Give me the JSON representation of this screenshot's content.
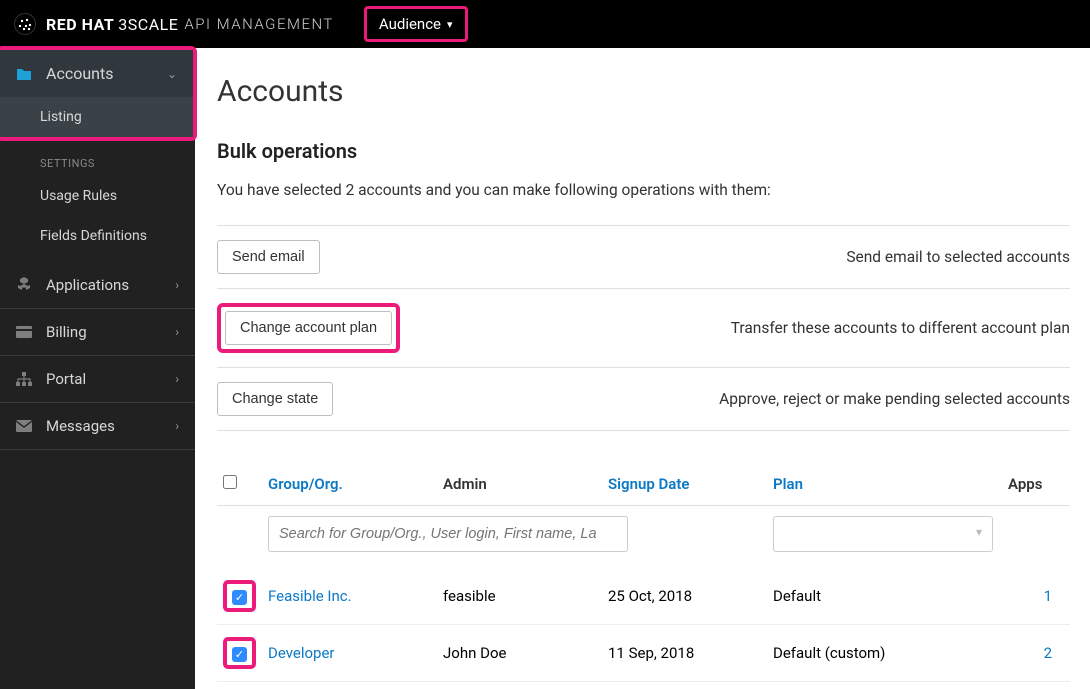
{
  "header": {
    "brand_strong": "RED HAT",
    "brand_mid": "3SCALE",
    "brand_sub": "API MANAGEMENT",
    "dropdown_label": "Audience"
  },
  "sidebar": {
    "accounts": {
      "label": "Accounts",
      "listing": "Listing",
      "settings_head": "Settings",
      "usage_rules": "Usage Rules",
      "fields_defs": "Fields Definitions"
    },
    "applications": "Applications",
    "billing": "Billing",
    "portal": "Portal",
    "messages": "Messages"
  },
  "main": {
    "title": "Accounts",
    "bulk_title": "Bulk operations",
    "bulk_desc": "You have selected 2 accounts and you can make following operations with them:",
    "ops": [
      {
        "button": "Send email",
        "desc": "Send email to selected accounts"
      },
      {
        "button": "Change account plan",
        "desc": "Transfer these accounts to different account plan"
      },
      {
        "button": "Change state",
        "desc": "Approve, reject or make pending selected accounts"
      }
    ],
    "columns": {
      "group": "Group/Org.",
      "admin": "Admin",
      "signup": "Signup Date",
      "plan": "Plan",
      "apps": "Apps"
    },
    "search_placeholder": "Search for Group/Org., User login, First name, La",
    "rows": [
      {
        "group": "Feasible Inc.",
        "admin": "feasible",
        "signup": "25 Oct, 2018",
        "plan": "Default",
        "apps": "1"
      },
      {
        "group": "Developer",
        "admin": "John Doe",
        "signup": "11 Sep, 2018",
        "plan": "Default (custom)",
        "apps": "2"
      }
    ]
  }
}
